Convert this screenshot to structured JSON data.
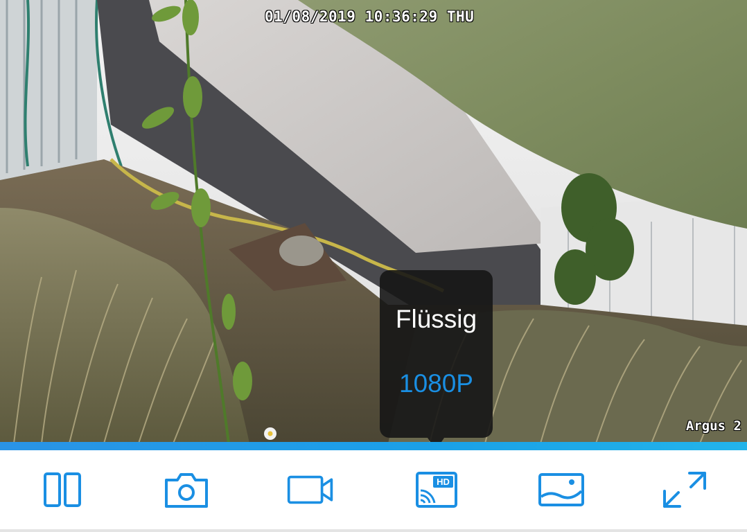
{
  "overlay": {
    "timestamp": "01/08/2019 10:36:29 THU",
    "camera_name": "Argus 2"
  },
  "quality_popup": {
    "options": [
      {
        "label": "Flüssig",
        "selected": false
      },
      {
        "label": "1080P",
        "selected": true
      }
    ]
  },
  "toolbar": {
    "accent_color": "#1a8fe3",
    "buttons": [
      {
        "icon": "split-view-icon"
      },
      {
        "icon": "camera-icon"
      },
      {
        "icon": "video-record-icon"
      },
      {
        "icon": "hd-quality-icon",
        "badge": "HD"
      },
      {
        "icon": "gallery-icon"
      },
      {
        "icon": "fullscreen-icon"
      }
    ]
  }
}
